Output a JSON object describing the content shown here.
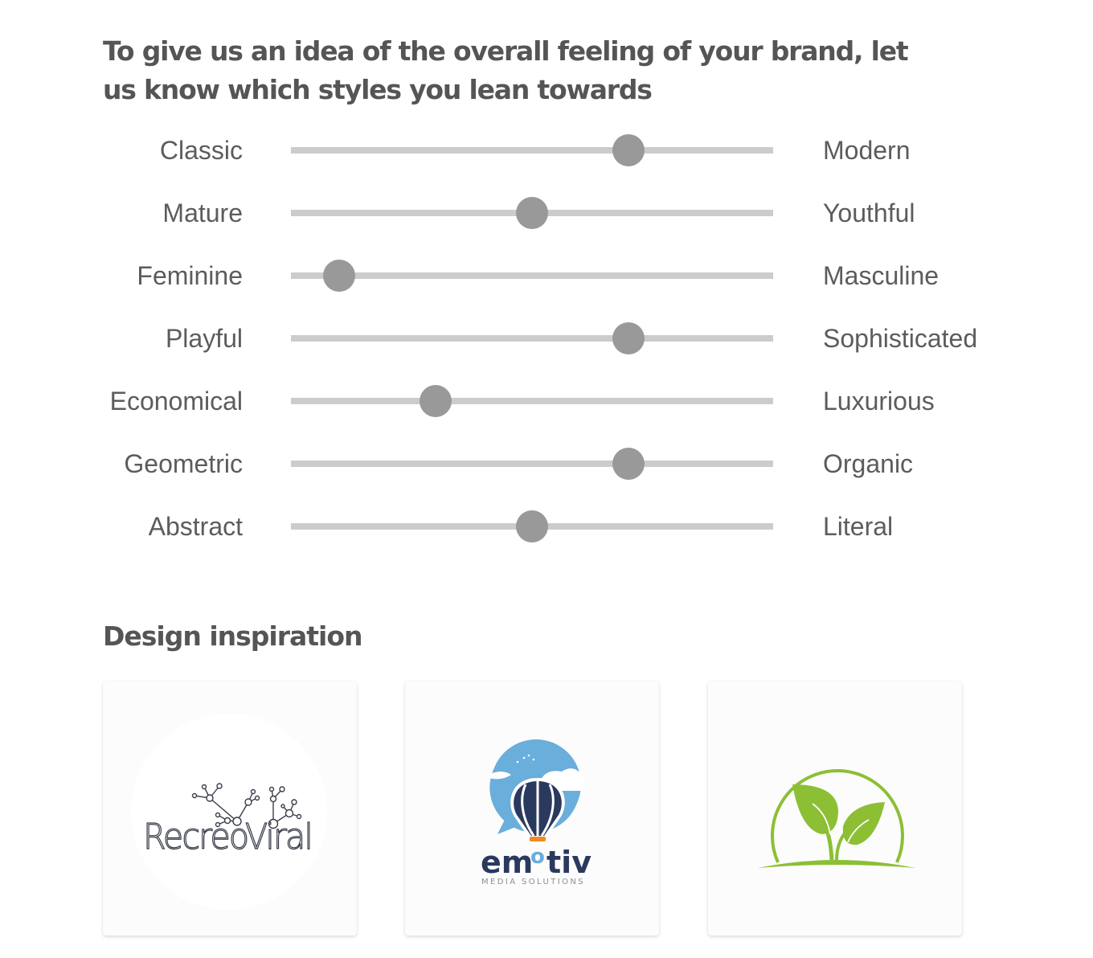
{
  "heading": "To give us an idea of the overall feeling of your brand, let us know which styles you lean towards",
  "sliders": [
    {
      "left": "Classic",
      "right": "Modern",
      "value": 0.7
    },
    {
      "left": "Mature",
      "right": "Youthful",
      "value": 0.5
    },
    {
      "left": "Feminine",
      "right": "Masculine",
      "value": 0.1
    },
    {
      "left": "Playful",
      "right": "Sophisticated",
      "value": 0.7
    },
    {
      "left": "Economical",
      "right": "Luxurious",
      "value": 0.3
    },
    {
      "left": "Geometric",
      "right": "Organic",
      "value": 0.7
    },
    {
      "left": "Abstract",
      "right": "Literal",
      "value": 0.5
    }
  ],
  "slider_colors": {
    "track": "#cccccc",
    "thumb": "#999999"
  },
  "inspiration": {
    "title": "Design inspiration",
    "cards": [
      {
        "name": "RecreoViral",
        "wordmark": "RecreoViral",
        "icon": "network-tree-icon"
      },
      {
        "name": "emotiv",
        "wordmark_parts": [
          "em",
          "o",
          "tiv"
        ],
        "tagline": "MEDIA SOLUTIONS",
        "icon": "hot-air-balloon-icon",
        "colors": {
          "navy": "#2a3a5e",
          "sky": "#6aaedb",
          "accent": "#f08a24"
        }
      },
      {
        "name": "green sprout",
        "icon": "sprout-leaf-icon",
        "colors": {
          "green": "#8cbf34"
        }
      }
    ]
  }
}
